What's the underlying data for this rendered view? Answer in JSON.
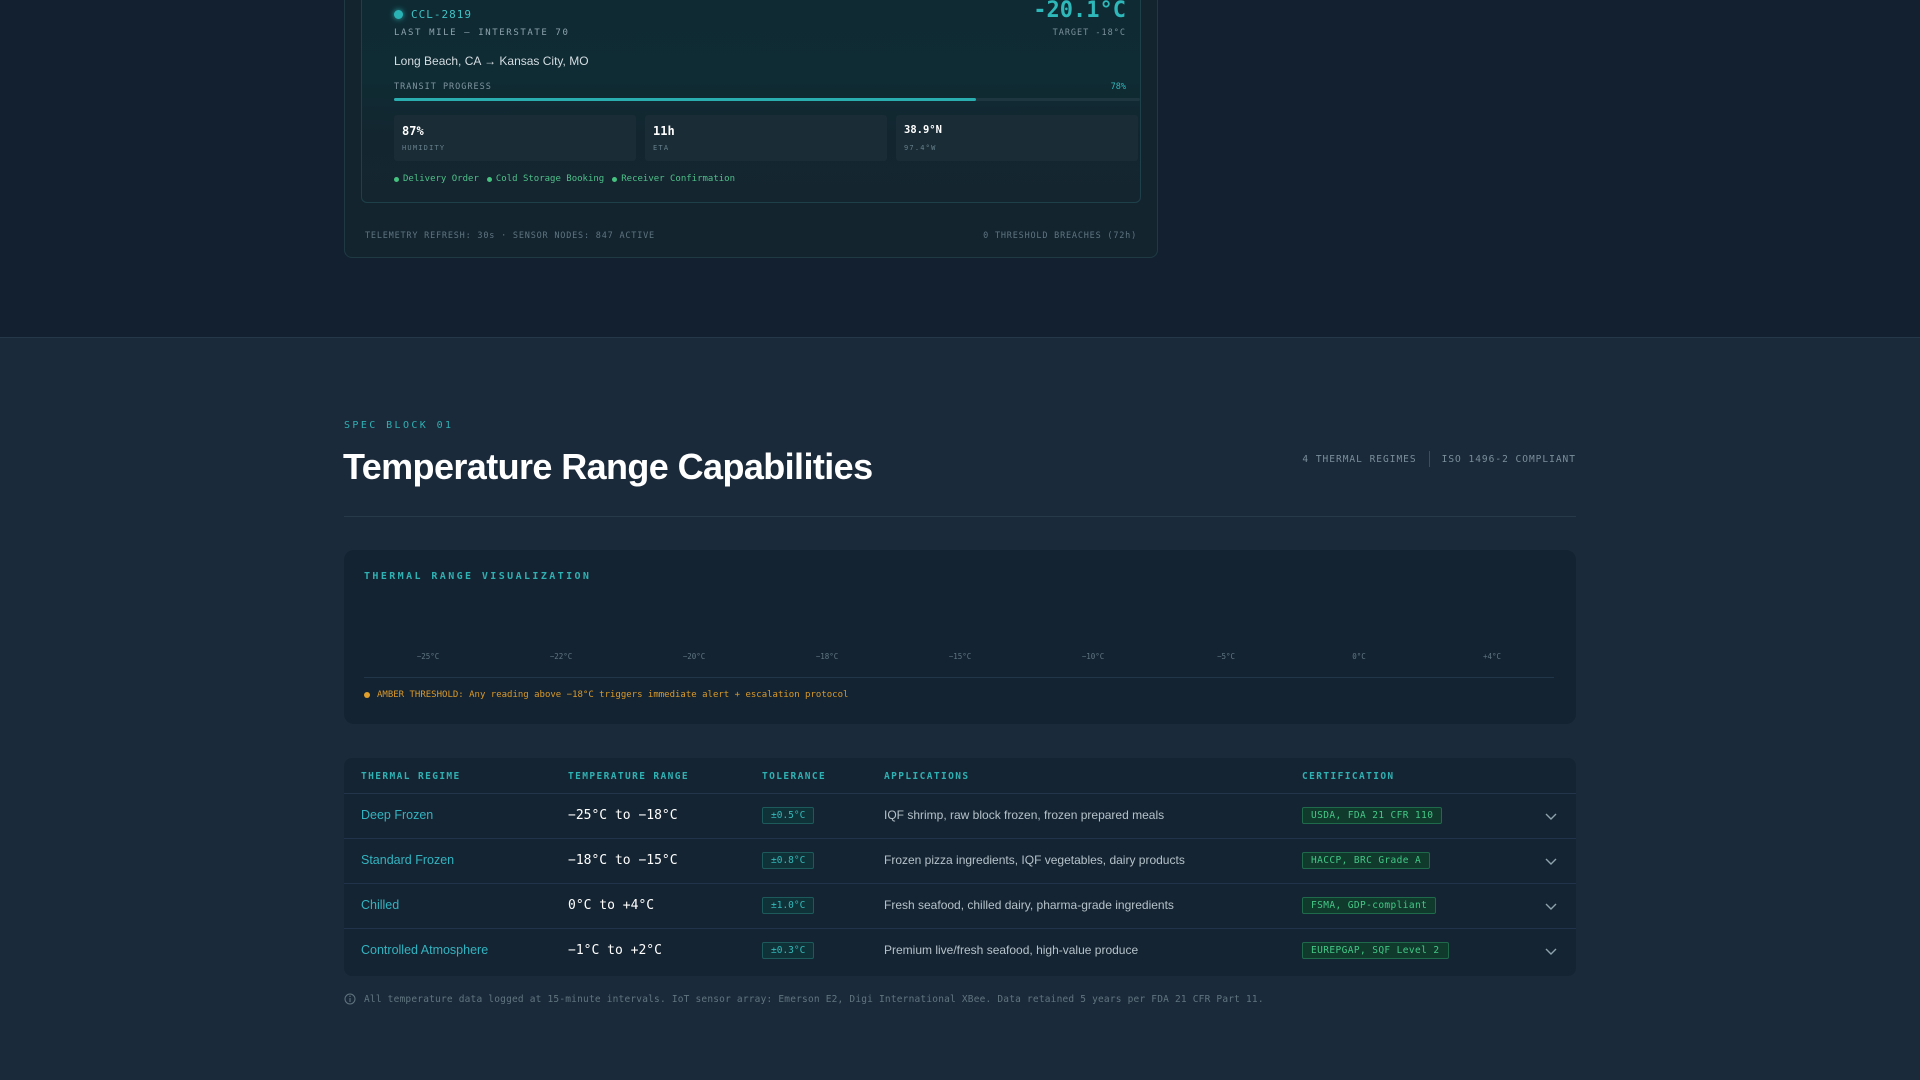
{
  "shipment": {
    "id": "CCL-2819",
    "subtitle": "LAST MILE — INTERSTATE 70",
    "current_temp": "-20.1°C",
    "target": "TARGET -18°C",
    "route": "Long Beach, CA → Kansas City, MO",
    "progress_label": "TRANSIT PROGRESS",
    "progress_text": "78%",
    "progress_value": 0.78,
    "metrics": [
      {
        "value": "87%",
        "label": "HUMIDITY"
      },
      {
        "value": "11h",
        "label": "ETA"
      },
      {
        "value": "38.9°N",
        "label": "97.4°W"
      }
    ],
    "documents": [
      "Delivery Order",
      "Cold Storage Booking",
      "Receiver Confirmation"
    ],
    "footer_left": "TELEMETRY REFRESH: 30s · SENSOR NODES: 847 ACTIVE",
    "footer_right": "0 THRESHOLD BREACHES (72h)"
  },
  "section": {
    "eyebrow": "SPEC BLOCK 01",
    "title": "Temperature Range Capabilities",
    "meta": [
      "4 THERMAL REGIMES",
      "ISO 1496-2 COMPLIANT"
    ]
  },
  "visualization": {
    "title": "THERMAL RANGE VISUALIZATION",
    "ticks": [
      "−25°C",
      "−22°C",
      "−20°C",
      "−18°C",
      "−15°C",
      "−10°C",
      "−5°C",
      "0°C",
      "+4°C"
    ],
    "note": "AMBER THRESHOLD: Any reading above −18°C triggers immediate alert + escalation protocol",
    "amber_color": "#e0a02b",
    "accent_color": "#2fb0b2"
  },
  "table": {
    "headers": [
      "THERMAL REGIME",
      "TEMPERATURE RANGE",
      "TOLERANCE",
      "APPLICATIONS",
      "CERTIFICATION"
    ],
    "rows": [
      {
        "regime": "Deep Frozen",
        "range": "−25°C to −18°C",
        "tolerance": "±0.5°C",
        "applications": "IQF shrimp, raw block frozen, frozen prepared meals",
        "certification": "USDA, FDA 21 CFR 110"
      },
      {
        "regime": "Standard Frozen",
        "range": "−18°C to −15°C",
        "tolerance": "±0.8°C",
        "applications": "Frozen pizza ingredients, IQF vegetables, dairy products",
        "certification": "HACCP, BRC Grade A"
      },
      {
        "regime": "Chilled",
        "range": "0°C to +4°C",
        "tolerance": "±1.0°C",
        "applications": "Fresh seafood, chilled dairy, pharma-grade ingredients",
        "certification": "FSMA, GDP-compliant"
      },
      {
        "regime": "Controlled Atmosphere",
        "range": "−1°C to +2°C",
        "tolerance": "±0.3°C",
        "applications": "Premium live/fresh seafood, high-value produce",
        "certification": "EUREPGAP, SQF Level 2"
      }
    ]
  },
  "footnote": "All temperature data logged at 15-minute intervals. IoT sensor array: Emerson E2, Digi International XBee. Data retained 5 years per FDA 21 CFR Part 11."
}
